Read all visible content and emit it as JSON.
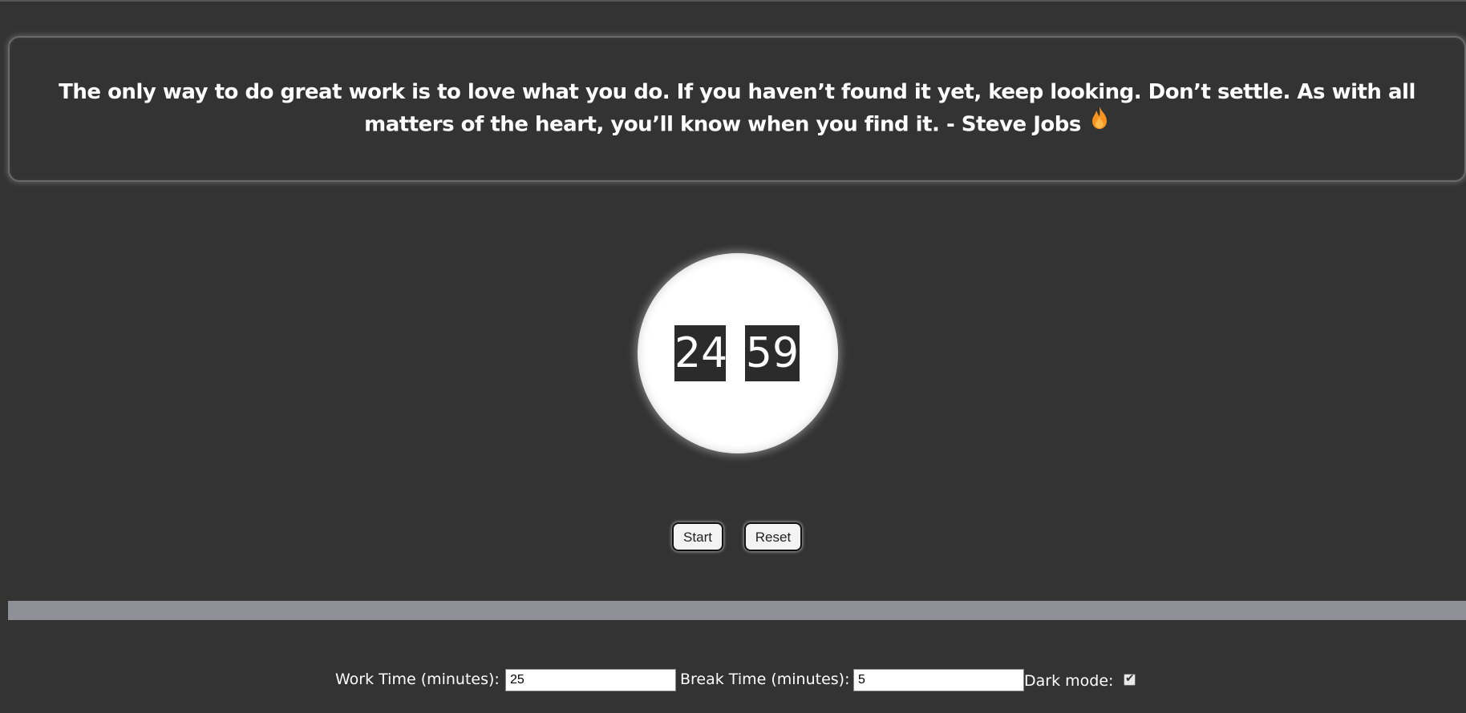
{
  "quote": {
    "text": "The only way to do great work is to love what you do. If you haven’t found it yet, keep looking. Don’t settle. As with all matters of the heart, you’ll know when you find it. - Steve Jobs",
    "icon": "flame-icon"
  },
  "timer": {
    "minutes": "24",
    "seconds": "59"
  },
  "controls": {
    "start_label": "Start",
    "reset_label": "Reset"
  },
  "progress": {
    "fraction": 0.0
  },
  "settings": {
    "work_label": "Work Time (minutes):",
    "work_value": "25",
    "break_label": "Break Time (minutes):",
    "break_value": "5",
    "dark_mode_label": "Dark mode:",
    "dark_mode_checked": true
  },
  "colors": {
    "background": "#333333",
    "progress_track": "#8f9196",
    "timer_circle": "#ffffff",
    "digit_box": "#2b2b2b",
    "flame": "#f7931e"
  }
}
